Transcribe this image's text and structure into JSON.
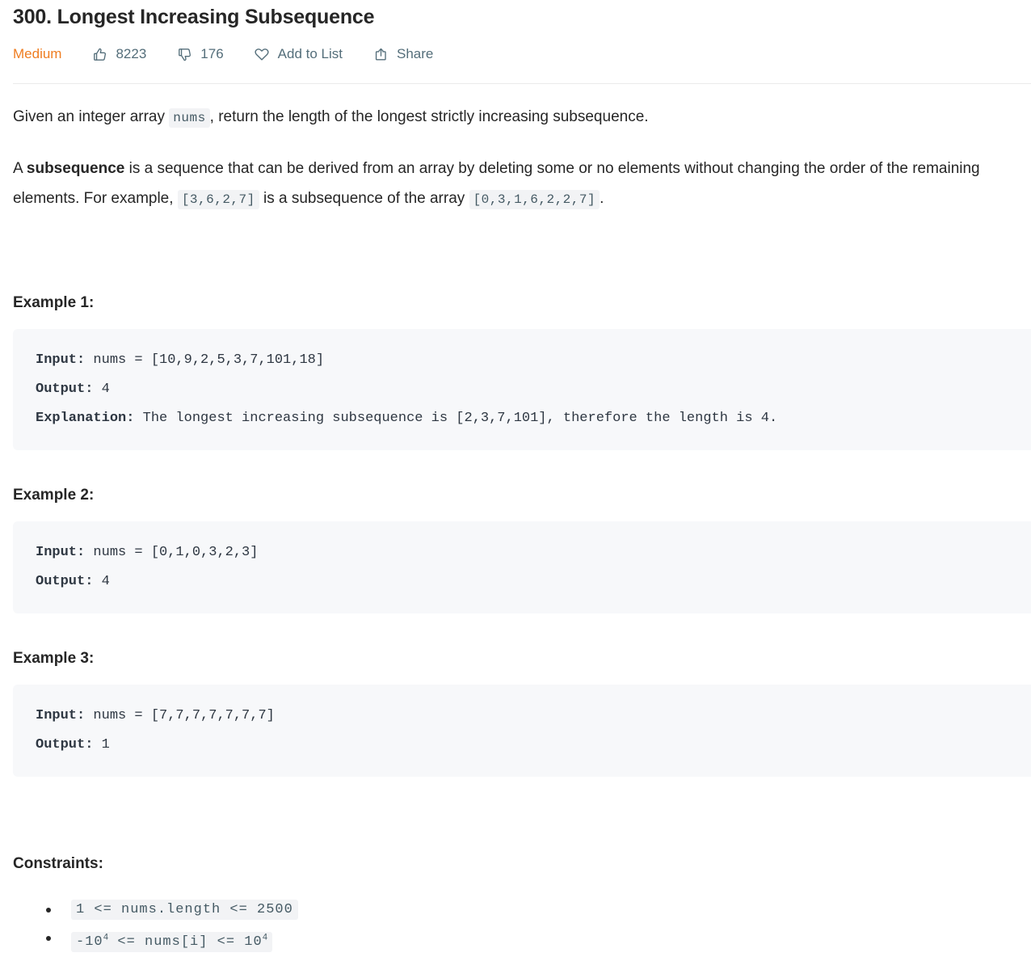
{
  "problem": {
    "title": "300. Longest Increasing Subsequence",
    "difficulty": "Medium",
    "difficulty_color": "#ef7d21"
  },
  "meta": {
    "likes": "8223",
    "dislikes": "176",
    "add_to_list": "Add to List",
    "share": "Share",
    "icons": {
      "likes": "thumbs-up-icon",
      "dislikes": "thumbs-down-icon",
      "add_to_list": "heart-icon",
      "share": "share-icon"
    }
  },
  "description": {
    "p1_before_code": "Given an integer array ",
    "p1_code": "nums",
    "p1_after_code": ", return the length of the longest strictly increasing subsequence.",
    "p2_part1": "A ",
    "p2_bold": "subsequence",
    "p2_part2": " is a sequence that can be derived from an array by deleting some or no elements without changing the order of the remaining elements. For example, ",
    "p2_code1": "[3,6,2,7]",
    "p2_part3": " is a subsequence of the array ",
    "p2_code2": "[0,3,1,6,2,2,7]",
    "p2_part4": "."
  },
  "examples": [
    {
      "heading": "Example 1:",
      "input_label": "Input:",
      "input_value": " nums = [10,9,2,5,3,7,101,18]",
      "output_label": "Output:",
      "output_value": " 4",
      "explanation_label": "Explanation:",
      "explanation_value": " The longest increasing subsequence is [2,3,7,101], therefore the length is 4."
    },
    {
      "heading": "Example 2:",
      "input_label": "Input:",
      "input_value": " nums = [0,1,0,3,2,3]",
      "output_label": "Output:",
      "output_value": " 4",
      "explanation_label": "",
      "explanation_value": ""
    },
    {
      "heading": "Example 3:",
      "input_label": "Input:",
      "input_value": " nums = [7,7,7,7,7,7,7]",
      "output_label": "Output:",
      "output_value": " 1",
      "explanation_label": "",
      "explanation_value": ""
    }
  ],
  "constraints": {
    "heading": "Constraints:",
    "items": [
      {
        "text": "1 <= nums.length <= 2500",
        "sup": ""
      },
      {
        "pre": "-10",
        "sup1": "4",
        "mid": " <= nums[i] <= 10",
        "sup2": "4"
      }
    ]
  }
}
